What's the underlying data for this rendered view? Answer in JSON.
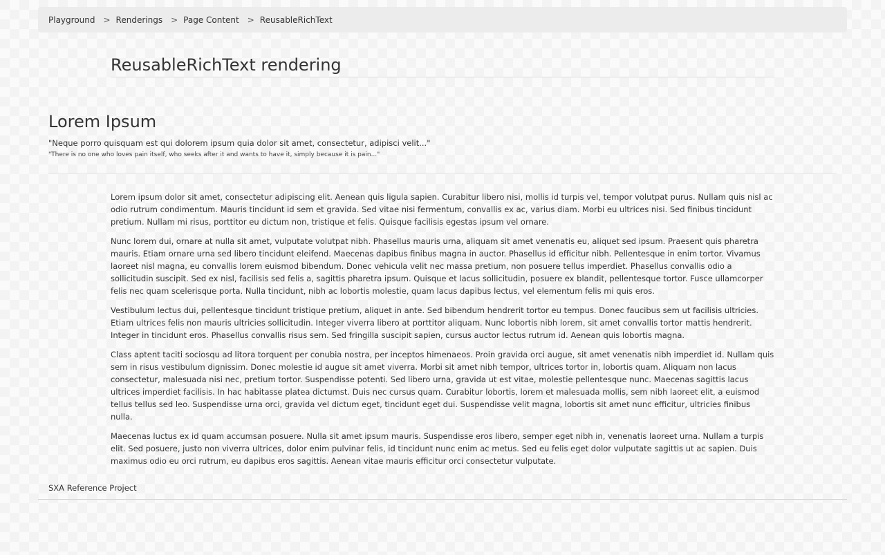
{
  "breadcrumb": {
    "items": [
      {
        "label": "Playground"
      },
      {
        "label": "Renderings"
      },
      {
        "label": "Page Content"
      },
      {
        "label": "ReusableRichText"
      }
    ],
    "separator": ">"
  },
  "rendering": {
    "title": "ReusableRichText rendering"
  },
  "hero": {
    "title": "Lorem Ipsum",
    "quote": "\"Neque porro quisquam est qui dolorem ipsum quia dolor sit amet, consectetur, adipisci velit...\"",
    "quote_translation": "\"There is no one who loves pain itself, who seeks after it and wants to have it, simply because it is pain...\""
  },
  "richtext": {
    "paragraphs": [
      "Lorem ipsum dolor sit amet, consectetur adipiscing elit. Aenean quis ligula sapien. Curabitur libero nisi, mollis id turpis vel, tempor volutpat purus. Nullam quis nisl ac odio rutrum condimentum. Mauris tincidunt id sem et gravida. Sed vitae nisi fermentum, convallis ex ac, varius diam. Morbi eu ultrices nisi. Sed finibus tincidunt pretium. Nullam mi risus, porttitor eu dictum non, tristique et felis. Quisque facilisis egestas ipsum vel ornare.",
      "Nunc lorem dui, ornare at nulla sit amet, vulputate volutpat nibh. Phasellus mauris urna, aliquam sit amet venenatis eu, aliquet sed ipsum. Praesent quis pharetra mauris. Etiam ornare urna sed libero tincidunt eleifend. Maecenas dapibus finibus magna in auctor. Phasellus id efficitur nibh. Pellentesque in enim tortor. Vivamus laoreet nisl magna, eu convallis lorem euismod bibendum. Donec vehicula velit nec massa pretium, non posuere tellus imperdiet. Phasellus convallis odio a sollicitudin suscipit. Sed ex nisl, facilisis sed felis a, sagittis pharetra ipsum. Quisque et lacus sollicitudin, posuere ex blandit, pellentesque tortor. Fusce ullamcorper felis nec quam scelerisque porta. Nulla tincidunt, nibh ac lobortis molestie, quam lacus dapibus lectus, vel elementum felis mi quis eros.",
      "Vestibulum lectus dui, pellentesque tincidunt tristique pretium, aliquet in ante. Sed bibendum hendrerit tortor eu tempus. Donec faucibus sem ut facilisis ultricies. Etiam ultrices felis non mauris ultricies sollicitudin. Integer viverra libero at porttitor aliquam. Nunc lobortis nibh lorem, sit amet convallis tortor mattis hendrerit. Integer in tincidunt eros. Phasellus convallis risus sem. Sed fringilla suscipit sapien, cursus auctor lectus rutrum id. Aenean quis lobortis magna.",
      "Class aptent taciti sociosqu ad litora torquent per conubia nostra, per inceptos himenaeos. Proin gravida orci augue, sit amet venenatis nibh imperdiet id. Nullam quis sem in risus vestibulum dignissim. Donec molestie id augue sit amet viverra. Morbi sit amet nibh tempor, ultrices tortor in, lobortis quam. Aliquam non lacus consectetur, malesuada nisi nec, pretium tortor. Suspendisse potenti. Sed libero urna, gravida ut est vitae, molestie pellentesque nunc. Maecenas sagittis lacus ultrices imperdiet facilisis. In hac habitasse platea dictumst. Duis nec cursus quam. Curabitur lobortis, lorem et malesuada mollis, sem nibh laoreet elit, a euismod tellus tellus sed leo. Suspendisse urna orci, gravida vel dictum eget, tincidunt eget dui. Suspendisse velit magna, lobortis sit amet nunc efficitur, ultricies finibus nulla.",
      "Maecenas luctus ex id quam accumsan posuere. Nulla sit amet ipsum mauris. Suspendisse eros libero, semper eget nibh in, venenatis laoreet urna. Nullam a turpis elit. Sed posuere, justo non viverra ultrices, dolor enim pulvinar felis, id tincidunt nunc enim ac metus. Sed eu felis eget dolor vulputate sagittis ut ac sapien. Duis maximus odio eu orci rutrum, eu dapibus eros sagittis. Aenean vitae mauris efficitur orci consectetur vulputate."
    ]
  },
  "footer": {
    "text": "SXA Reference Project"
  }
}
